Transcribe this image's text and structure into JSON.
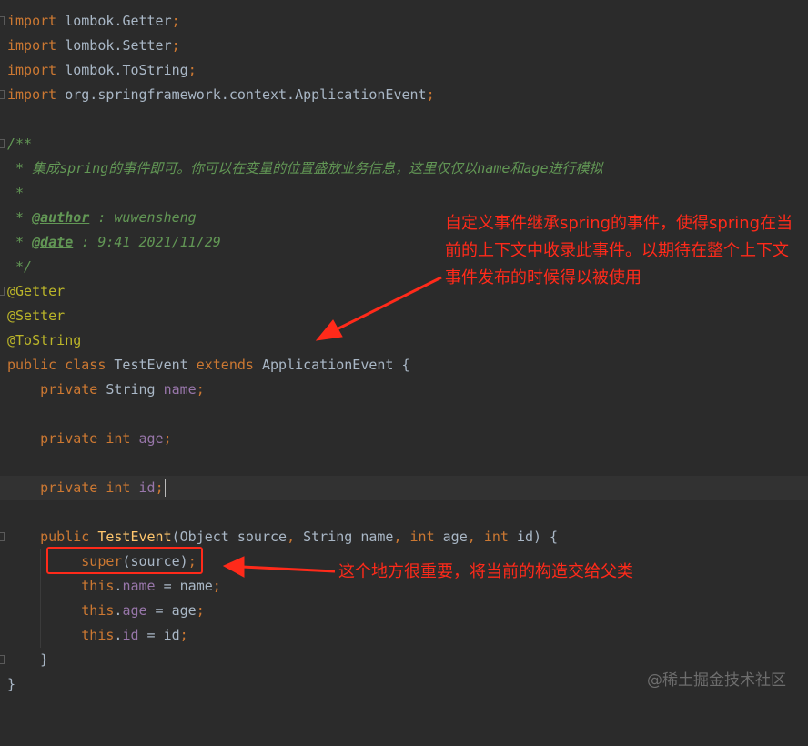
{
  "editor": {
    "lines": {
      "imp1": {
        "kw": "import",
        "pkg": "lombok.",
        "cls": "Getter",
        "end": ";"
      },
      "imp2": {
        "kw": "import",
        "pkg": "lombok.",
        "cls": "Setter",
        "end": ";"
      },
      "imp3": {
        "kw": "import",
        "pkg": "lombok.",
        "cls": "ToString",
        "end": ";"
      },
      "imp4": {
        "kw": "import",
        "pkg": "org.springframework.context.",
        "cls": "ApplicationEvent",
        "end": ";"
      },
      "doc_open": "/**",
      "doc_desc": " * 集成spring的事件即可。你可以在变量的位置盛放业务信息，这里仅仅以name和age进行模拟",
      "doc_star": " *",
      "doc_author_prefix": " * ",
      "doc_author_tag": "@author",
      "doc_author_val": " : wuwensheng",
      "doc_date_prefix": " * ",
      "doc_date_tag": "@date",
      "doc_date_val": " : 9:41 2021/11/29",
      "doc_close": " */",
      "ann1": "@Getter",
      "ann2": "@Setter",
      "ann3": "@ToString",
      "cls_public": "public",
      "cls_class": "class",
      "cls_name": "TestEvent",
      "cls_extends": "extends",
      "cls_parent": "ApplicationEvent",
      "cls_brace": "{",
      "f1_mod": "private",
      "f1_type": "String",
      "f1_name": "name",
      "f2_mod": "private",
      "f2_type": "int",
      "f2_name": "age",
      "f3_mod": "private",
      "f3_type": "int",
      "f3_name": "id",
      "semi": ";",
      "ctor_public": "public",
      "ctor_name": "TestEvent",
      "ctor_p1_type": "Object",
      "ctor_p1_name": "source",
      "ctor_p2_type": "String",
      "ctor_p2_name": "name",
      "ctor_p3_type": "int",
      "ctor_p3_name": "age",
      "ctor_p4_type": "int",
      "ctor_p4_name": "id",
      "super_kw": "super",
      "super_arg": "(source)",
      "this_kw": "this",
      "assign_name_field": "name",
      "assign_name_val": " = name",
      "assign_age_field": "age",
      "assign_age_val": " = age",
      "assign_id_field": "id",
      "assign_id_val": " = id",
      "close_ctor": "}",
      "close_cls": "}"
    }
  },
  "annotations": {
    "note1": "自定义事件继承spring的事件，使得spring在当前的上下文中收录此事件。以期待在整个上下文事件发布的时候得以被使用",
    "note2": "这个地方很重要，将当前的构造交给父类",
    "accent_color": "#ff2a1a"
  },
  "watermark": "@稀土掘金技术社区"
}
